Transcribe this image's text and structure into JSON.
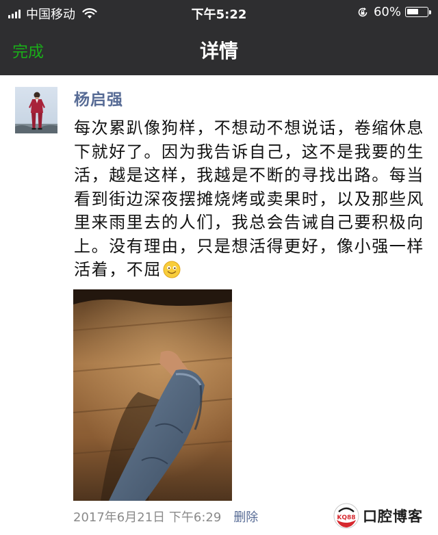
{
  "status_bar": {
    "carrier": "中国移动",
    "time": "下午5:22",
    "battery_text": "60%",
    "battery_level": 0.6,
    "icons": [
      "signal-icon",
      "wifi-icon",
      "rotation-lock-icon",
      "battery-icon"
    ]
  },
  "nav": {
    "done_label": "完成",
    "title": "详情"
  },
  "post": {
    "author": "杨启强",
    "text": "每次累趴像狗样，不想动不想说话，卷缩休息下就好了。因为我告诉自己，这不是我要的生活，越是这样，我越是不断的寻找出路。每当看到街边深夜摆摊烧烤或卖果时，以及那些风里来雨里去的人们，我总会告诫自己要积极向上。没有理由，只是想活得更好，像小强一样活着，不屈",
    "emoji": "smile-emoji-icon",
    "timestamp": "2017年6月21日 下午6:29",
    "delete_label": "删除"
  },
  "watermark": {
    "logo_text": "KQ88",
    "text": "口腔博客"
  },
  "colors": {
    "bar_background": "#2e2e30",
    "done_green": "#1aad19",
    "link_blue": "#576b95"
  }
}
